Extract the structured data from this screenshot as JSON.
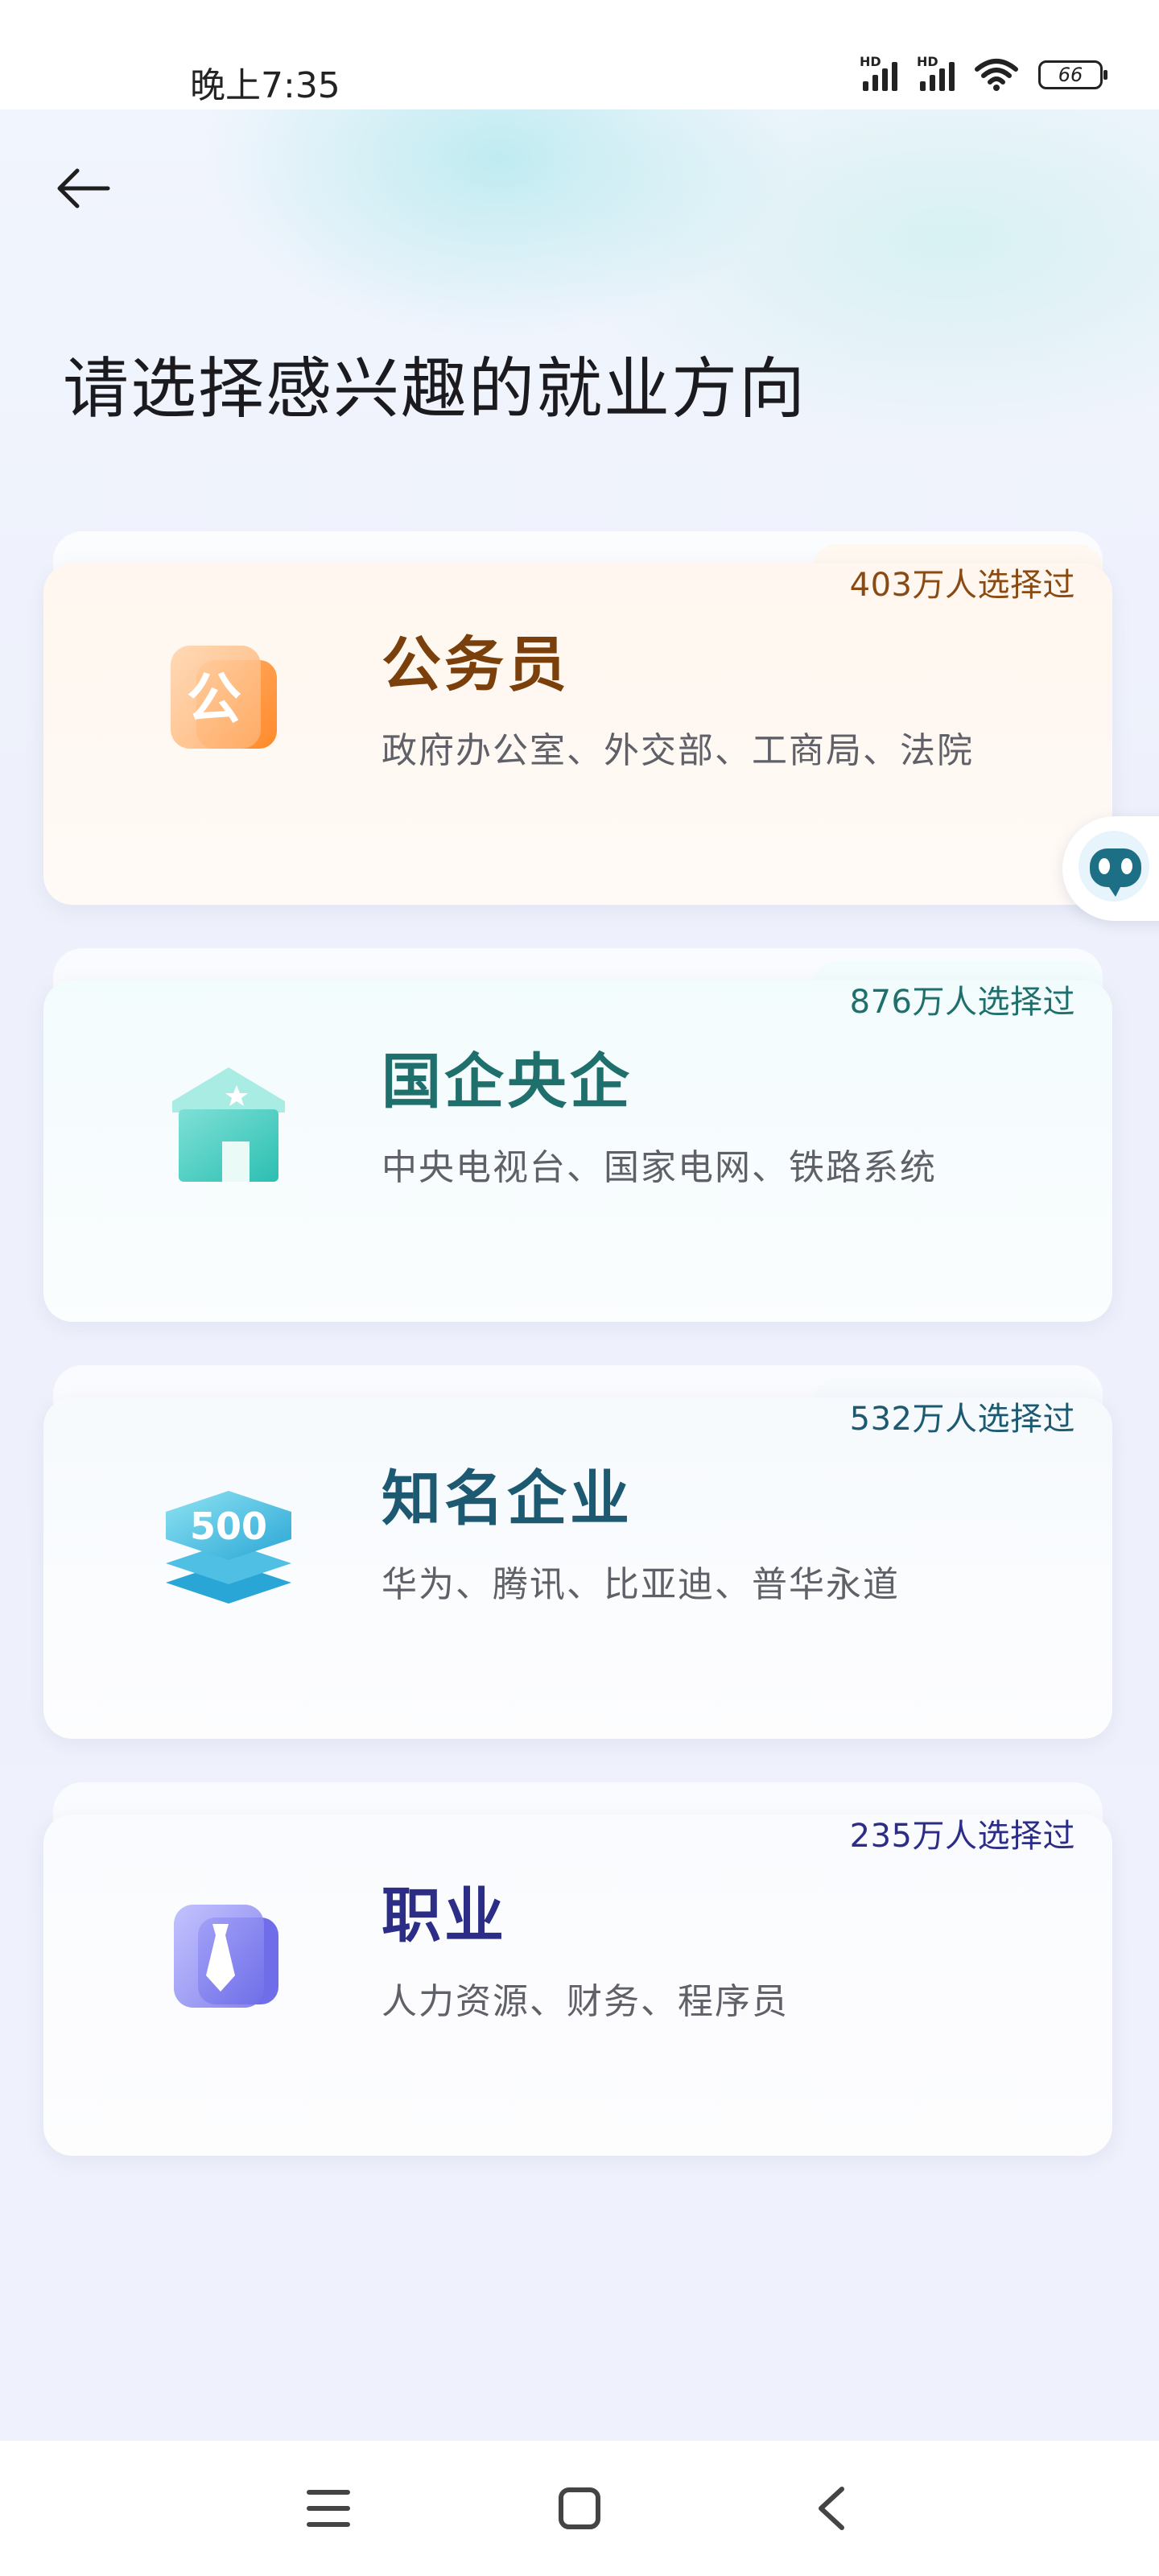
{
  "status_bar": {
    "time": "晚上7:35",
    "signal_1_label": "HD",
    "signal_2_label": "HD",
    "battery": "66"
  },
  "header": {
    "back_icon": "arrow-left-icon",
    "title": "请选择感兴趣的就业方向"
  },
  "cards": [
    {
      "badge": "403万人选择过",
      "icon": "civil-servant-icon",
      "icon_text": "公",
      "title": "公务员",
      "desc": "政府办公室、外交部、工商局、法院",
      "accent": "#7a3f0a"
    },
    {
      "badge": "876万人选择过",
      "icon": "state-enterprise-building-icon",
      "title": "国企央企",
      "desc": "中央电视台、国家电网、铁路系统",
      "accent": "#1f6f6c"
    },
    {
      "badge": "532万人选择过",
      "icon": "top500-stack-icon",
      "icon_text": "500",
      "title": "知名企业",
      "desc": "华为、腾讯、比亚迪、普华永道",
      "accent": "#1d5a72"
    },
    {
      "badge": "235万人选择过",
      "icon": "profession-tie-icon",
      "title": "职业",
      "desc": "人力资源、财务、程序员",
      "accent": "#2b2d86"
    }
  ],
  "floating": {
    "icon": "robot-assistant-icon"
  },
  "nav_bar": {
    "menu_icon": "menu-icon",
    "home_icon": "home-square-icon",
    "back_icon": "back-chevron-icon"
  }
}
